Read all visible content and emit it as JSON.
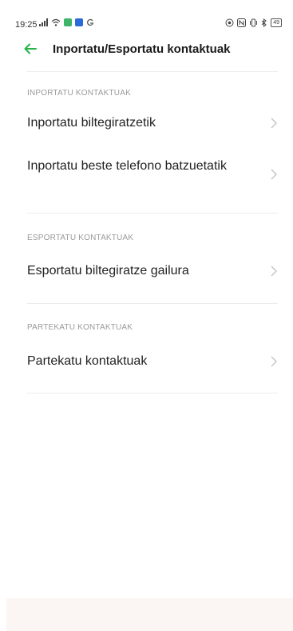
{
  "status_bar": {
    "time": "19:25",
    "left_icons": [
      "signal-icon",
      "wifi-icon",
      "app-icon-green",
      "app-icon-blue",
      "g-icon"
    ],
    "right_icons": [
      "eye-icon",
      "nfc-icon",
      "vibrate-icon",
      "bluetooth-icon"
    ],
    "battery": "49"
  },
  "toolbar": {
    "title": "Inportatu/Esportatu kontaktuak",
    "back_icon": "arrow-left-icon",
    "accent_color": "#27b34a"
  },
  "sections": [
    {
      "header": "INPORTATU KONTAKTUAK",
      "items": [
        {
          "label": "Inportatu biltegiratzetik"
        },
        {
          "label": "Inportatu beste telefono batzuetatik"
        }
      ]
    },
    {
      "header": "ESPORTATU KONTAKTUAK",
      "items": [
        {
          "label": "Esportatu biltegiratze gailura"
        }
      ]
    },
    {
      "header": "PARTEKATU KONTAKTUAK",
      "items": [
        {
          "label": "Partekatu kontaktuak"
        }
      ]
    }
  ]
}
